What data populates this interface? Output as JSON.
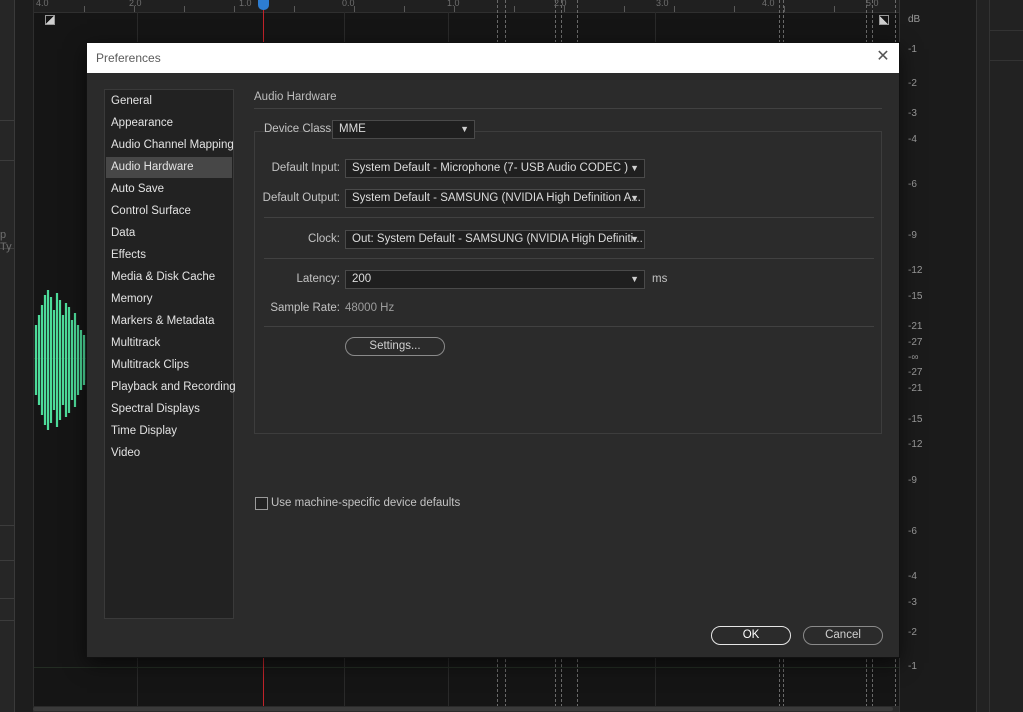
{
  "background": {
    "ruler_labels": [
      "4.0",
      "2.0",
      "1.0",
      "0.0",
      "1.0",
      "2.0",
      "3.0",
      "4.0",
      "5.0"
    ],
    "db_unit": "dB",
    "db_labels": [
      "-1",
      "-2",
      "-3",
      "-4",
      "-6",
      "-9",
      "-12",
      "-15",
      "-21",
      "-27",
      "-∞",
      "-27",
      "-21",
      "-15",
      "-12",
      "-9",
      "-6",
      "-4",
      "-3",
      "-2",
      "-1"
    ],
    "left_panel_fragment": "p Ty"
  },
  "dialog": {
    "title": "Preferences",
    "close_glyph": "✕",
    "sidebar": {
      "items": [
        {
          "label": "General"
        },
        {
          "label": "Appearance"
        },
        {
          "label": "Audio Channel Mapping"
        },
        {
          "label": "Audio Hardware"
        },
        {
          "label": "Auto Save"
        },
        {
          "label": "Control Surface"
        },
        {
          "label": "Data"
        },
        {
          "label": "Effects"
        },
        {
          "label": "Media & Disk Cache"
        },
        {
          "label": "Memory"
        },
        {
          "label": "Markers & Metadata"
        },
        {
          "label": "Multitrack"
        },
        {
          "label": "Multitrack Clips"
        },
        {
          "label": "Playback and Recording"
        },
        {
          "label": "Spectral Displays"
        },
        {
          "label": "Time Display"
        },
        {
          "label": "Video"
        }
      ],
      "selected": "Audio Hardware"
    },
    "panel": {
      "section_title": "Audio Hardware",
      "device_class": {
        "label": "Device Class:",
        "value": "MME"
      },
      "default_input": {
        "label": "Default Input:",
        "value": "System Default - Microphone (7- USB Audio CODEC )"
      },
      "default_output": {
        "label": "Default Output:",
        "value": "System Default - SAMSUNG (NVIDIA High Definition A..."
      },
      "clock": {
        "label": "Clock:",
        "value": "Out: System Default - SAMSUNG (NVIDIA High Definiti..."
      },
      "latency": {
        "label": "Latency:",
        "value": "200",
        "unit": "ms"
      },
      "sample_rate": {
        "label": "Sample Rate:",
        "value": "48000 Hz"
      },
      "settings_button": "Settings...",
      "machine_defaults_checkbox": {
        "label": "Use machine-specific device defaults",
        "checked": false
      }
    },
    "footer": {
      "ok_label": "OK",
      "cancel_label": "Cancel"
    }
  },
  "colors": {
    "dialog_bg": "#2b2b2b",
    "selected_item_bg": "#474747",
    "waveform": "#4ddb9a",
    "playhead": "#c2232a",
    "playhead_handle": "#2d7dd2"
  }
}
